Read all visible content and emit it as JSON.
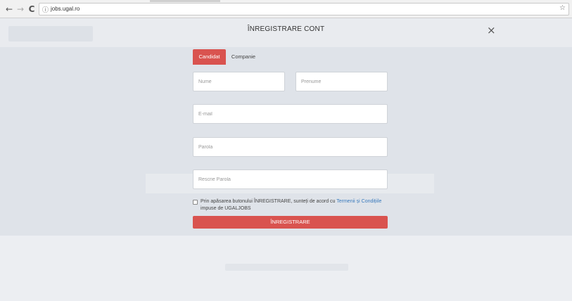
{
  "browser": {
    "nav_back": "←",
    "nav_forward": "→",
    "nav_reload": "C",
    "info_icon": "ⓘ",
    "url": "jobs.ugal.ro",
    "star": "☆"
  },
  "modal": {
    "title": "ÎNREGISTRARE CONT",
    "close": "×",
    "tabs": [
      {
        "label": "Candidat",
        "active": true
      },
      {
        "label": "Companie",
        "active": false
      }
    ],
    "fields": {
      "nume": "Nume",
      "prenume": "Prenume",
      "email": "E-mail",
      "parola": "Parola",
      "rescrie_parola": "Rescrie Parola"
    },
    "terms": {
      "before": "Prin apăsarea butonului ÎNREGISTRARE, sunteți de acord cu ",
      "link": "Termenii și Condițiile",
      "after": " impuse de UGALJOBS"
    },
    "submit_label": "ÎNREGISTRARE"
  },
  "colors": {
    "accent": "#d9534f",
    "link": "#3a7bbd"
  }
}
